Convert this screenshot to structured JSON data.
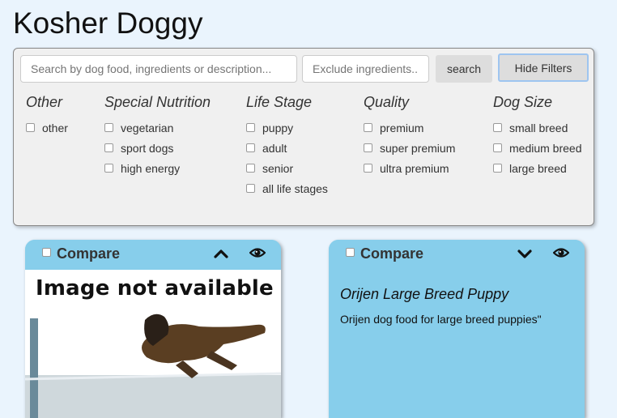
{
  "app": {
    "title": "Kosher Doggy"
  },
  "search": {
    "placeholder": "Search by dog food, ingredients or description...",
    "exclude_placeholder": "Exclude ingredients..",
    "search_label": "search",
    "hide_filters_label": "Hide Filters"
  },
  "filters": [
    {
      "title": "Other",
      "options": [
        "other"
      ]
    },
    {
      "title": "Special Nutrition",
      "options": [
        "vegetarian",
        "sport dogs",
        "high energy"
      ]
    },
    {
      "title": "Life Stage",
      "options": [
        "puppy",
        "adult",
        "senior",
        "all life stages"
      ]
    },
    {
      "title": "Quality",
      "options": [
        "premium",
        "super premium",
        "ultra premium"
      ]
    },
    {
      "title": "Dog Size",
      "options": [
        "small breed",
        "medium breed",
        "large breed"
      ]
    }
  ],
  "cards": [
    {
      "compare_label": "Compare",
      "image_text": "Image not available",
      "collapse_icon": "chevron-up-icon",
      "view_icon": "eye-icon"
    },
    {
      "compare_label": "Compare",
      "name": "Orijen Large Breed Puppy",
      "description": "Orijen dog food for large breed puppies\"",
      "collapse_icon": "chevron-down-icon",
      "view_icon": "eye-icon"
    }
  ],
  "colors": {
    "card_header": "#87ceeb",
    "background": "#eaf4fd",
    "panel": "#f0f0f0"
  }
}
